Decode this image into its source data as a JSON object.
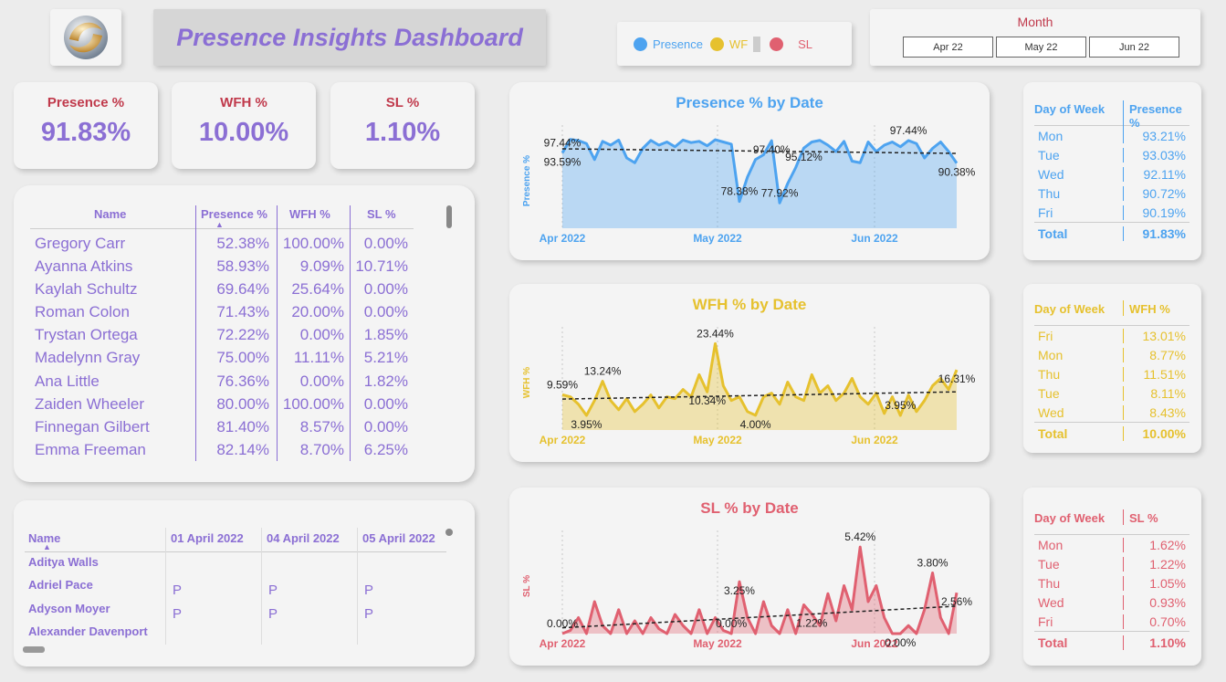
{
  "header": {
    "title": "Presence Insights Dashboard"
  },
  "legend": {
    "items": [
      {
        "label": "Presence",
        "color": "#4da3f0"
      },
      {
        "label": "WF",
        "color": "#e6c12e"
      },
      {
        "label": "SL",
        "color": "#e06070"
      }
    ]
  },
  "month_slicer": {
    "label": "Month",
    "options": [
      "Apr 22",
      "May 22",
      "Jun 22"
    ]
  },
  "kpis": [
    {
      "label": "Presence %",
      "value": "91.83%"
    },
    {
      "label": "WFH %",
      "value": "10.00%"
    },
    {
      "label": "SL %",
      "value": "1.10%"
    }
  ],
  "employee_table": {
    "headers": [
      "Name",
      "Presence %",
      "WFH %",
      "SL %"
    ],
    "rows": [
      [
        "Gregory Carr",
        "52.38%",
        "100.00%",
        "0.00%"
      ],
      [
        "Ayanna Atkins",
        "58.93%",
        "9.09%",
        "10.71%"
      ],
      [
        "Kaylah Schultz",
        "69.64%",
        "25.64%",
        "0.00%"
      ],
      [
        "Roman Colon",
        "71.43%",
        "20.00%",
        "0.00%"
      ],
      [
        "Trystan Ortega",
        "72.22%",
        "0.00%",
        "1.85%"
      ],
      [
        "Madelynn Gray",
        "75.00%",
        "11.11%",
        "5.21%"
      ],
      [
        "Ana Little",
        "76.36%",
        "0.00%",
        "1.82%"
      ],
      [
        "Zaiden Wheeler",
        "80.00%",
        "100.00%",
        "0.00%"
      ],
      [
        "Finnegan Gilbert",
        "81.40%",
        "8.57%",
        "0.00%"
      ],
      [
        "Emma Freeman",
        "82.14%",
        "8.70%",
        "6.25%"
      ]
    ]
  },
  "attendance_matrix": {
    "headers": [
      "Name",
      "01 April 2022",
      "04 April 2022",
      "05 April 2022"
    ],
    "rows": [
      [
        "Aditya Walls",
        "",
        "",
        ""
      ],
      [
        "Adriel Pace",
        "P",
        "P",
        "P"
      ],
      [
        "Adyson Moyer",
        "P",
        "P",
        "P"
      ],
      [
        "Alexander Davenport",
        "",
        "",
        ""
      ]
    ]
  },
  "chart_data": [
    {
      "type": "area",
      "title": "Presence % by Date",
      "ylabel": "Presence %",
      "x_ticks": [
        "Apr 2022",
        "May 2022",
        "Jun 2022"
      ],
      "color": "#4da3f0",
      "ylim": [
        70,
        100
      ],
      "values": [
        93.59,
        97.8,
        97.44,
        96.5,
        91.5,
        97.2,
        96.0,
        97.6,
        92.0,
        90.5,
        95.0,
        97.5,
        96.0,
        97.0,
        95.5,
        97.6,
        96.8,
        97.2,
        95.8,
        97.7,
        97.0,
        96.3,
        78.38,
        86.0,
        91.5,
        93.0,
        97.4,
        77.92,
        84.0,
        89.0,
        95.1,
        97.0,
        97.5,
        96.0,
        94.0,
        97.2,
        91.0,
        90.5,
        97.0,
        94.0,
        96.0,
        97.0,
        95.5,
        97.44,
        96.5,
        92.0,
        95.0,
        97.0,
        94.0,
        90.38
      ],
      "annotations": [
        {
          "i": 0,
          "text": "97.44%"
        },
        {
          "i": 0,
          "text": "93.59%"
        },
        {
          "i": 22,
          "text": "78.38%"
        },
        {
          "i": 26,
          "text": "97.40%"
        },
        {
          "i": 27,
          "text": "77.92%"
        },
        {
          "i": 30,
          "text": "95.12%"
        },
        {
          "i": 43,
          "text": "97.44%"
        },
        {
          "i": 49,
          "text": "90.38%"
        }
      ]
    },
    {
      "type": "area",
      "title": "WFH % by Date",
      "ylabel": "WFH %",
      "x_ticks": [
        "Apr 2022",
        "May 2022",
        "Jun 2022"
      ],
      "color": "#e6c12e",
      "ylim": [
        0,
        26
      ],
      "values": [
        9.59,
        9.0,
        7.0,
        3.95,
        8.0,
        13.24,
        8.0,
        5.5,
        8.5,
        5.0,
        7.0,
        9.5,
        6.0,
        9.0,
        8.5,
        11.0,
        9.0,
        15.0,
        10.34,
        23.44,
        12.0,
        8.0,
        9.0,
        5.0,
        4.0,
        9.0,
        10.0,
        7.0,
        13.0,
        9.0,
        8.0,
        15.0,
        10.0,
        12.0,
        8.0,
        10.0,
        14.0,
        9.0,
        7.0,
        10.0,
        4.5,
        9.0,
        3.95,
        9.5,
        5.0,
        8.0,
        12.0,
        14.0,
        11.0,
        16.31
      ],
      "annotations": [
        {
          "i": 0,
          "text": "9.59%"
        },
        {
          "i": 3,
          "text": "3.95%"
        },
        {
          "i": 5,
          "text": "13.24%"
        },
        {
          "i": 18,
          "text": "10.34%"
        },
        {
          "i": 19,
          "text": "23.44%"
        },
        {
          "i": 24,
          "text": "4.00%"
        },
        {
          "i": 42,
          "text": "3.95%"
        },
        {
          "i": 49,
          "text": "16.31%"
        }
      ]
    },
    {
      "type": "area",
      "title": "SL % by Date",
      "ylabel": "SL %",
      "x_ticks": [
        "Apr 2022",
        "May 2022",
        "Jun 2022"
      ],
      "color": "#e06070",
      "ylim": [
        0,
        6
      ],
      "values": [
        0.0,
        0.2,
        1.0,
        0.0,
        2.0,
        0.5,
        0.0,
        1.5,
        0.0,
        0.8,
        0.0,
        1.0,
        0.3,
        0.0,
        1.2,
        0.5,
        0.0,
        1.5,
        0.0,
        1.0,
        0.2,
        0.0,
        3.25,
        1.0,
        0.0,
        2.0,
        0.5,
        0.0,
        1.5,
        0.0,
        1.8,
        1.22,
        0.5,
        2.5,
        0.8,
        3.0,
        1.5,
        5.42,
        2.0,
        3.0,
        1.0,
        0.0,
        0.0,
        0.5,
        0.0,
        1.5,
        3.8,
        1.0,
        0.0,
        2.56
      ],
      "annotations": [
        {
          "i": 0,
          "text": "0.00%"
        },
        {
          "i": 22,
          "text": "3.25%"
        },
        {
          "i": 21,
          "text": "0.00%"
        },
        {
          "i": 31,
          "text": "1.22%"
        },
        {
          "i": 37,
          "text": "5.42%"
        },
        {
          "i": 42,
          "text": "0.00%"
        },
        {
          "i": 46,
          "text": "3.80%"
        },
        {
          "i": 49,
          "text": "2.56%"
        }
      ]
    },
    {
      "type": "table",
      "headers": [
        "Day of Week",
        "Presence %"
      ],
      "color": "#4da3f0",
      "rows": [
        [
          "Mon",
          "93.21%"
        ],
        [
          "Tue",
          "93.03%"
        ],
        [
          "Wed",
          "92.11%"
        ],
        [
          "Thu",
          "90.72%"
        ],
        [
          "Fri",
          "90.19%"
        ]
      ],
      "total": [
        "Total",
        "91.83%"
      ]
    },
    {
      "type": "table",
      "headers": [
        "Day of Week",
        "WFH %"
      ],
      "color": "#e6c12e",
      "rows": [
        [
          "Fri",
          "13.01%"
        ],
        [
          "Mon",
          "8.77%"
        ],
        [
          "Thu",
          "11.51%"
        ],
        [
          "Tue",
          "8.11%"
        ],
        [
          "Wed",
          "8.43%"
        ]
      ],
      "total": [
        "Total",
        "10.00%"
      ]
    },
    {
      "type": "table",
      "headers": [
        "Day of Week",
        "SL %"
      ],
      "color": "#e06070",
      "rows": [
        [
          "Mon",
          "1.62%"
        ],
        [
          "Tue",
          "1.22%"
        ],
        [
          "Thu",
          "1.05%"
        ],
        [
          "Wed",
          "0.93%"
        ],
        [
          "Fri",
          "0.70%"
        ]
      ],
      "total": [
        "Total",
        "1.10%"
      ]
    }
  ]
}
